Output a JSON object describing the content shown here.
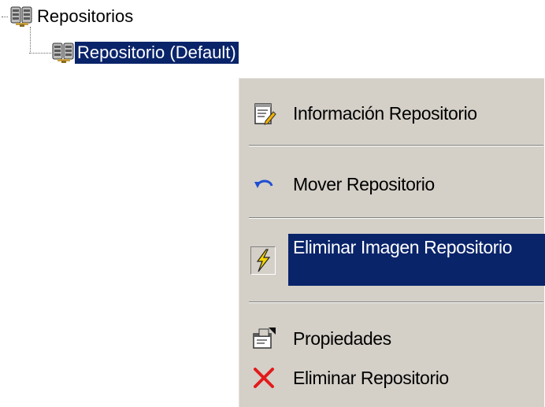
{
  "tree": {
    "root": {
      "label": "Repositorios",
      "icon": "database-cluster-icon"
    },
    "child": {
      "label": "Repositorio (Default)",
      "icon": "database-cluster-icon",
      "selected": true
    }
  },
  "context_menu": {
    "items": [
      {
        "label": "Información Repositorio",
        "icon": "notepad-edit-icon"
      },
      {
        "label": "Mover Repositorio",
        "icon": "undo-arrow-icon"
      },
      {
        "label": "Eliminar Imagen Repositorio",
        "icon": "lightning-icon",
        "highlighted": true
      },
      {
        "label": "Propiedades",
        "icon": "properties-icon"
      },
      {
        "label": "Eliminar Repositorio",
        "icon": "red-x-icon"
      }
    ]
  },
  "colors": {
    "selection": "#0a246a",
    "menu_background": "#d4d0c8",
    "delete_red": "#e31b1b",
    "arrow_blue": "#1f4fd1",
    "lightning_yellow": "#f5d400"
  }
}
